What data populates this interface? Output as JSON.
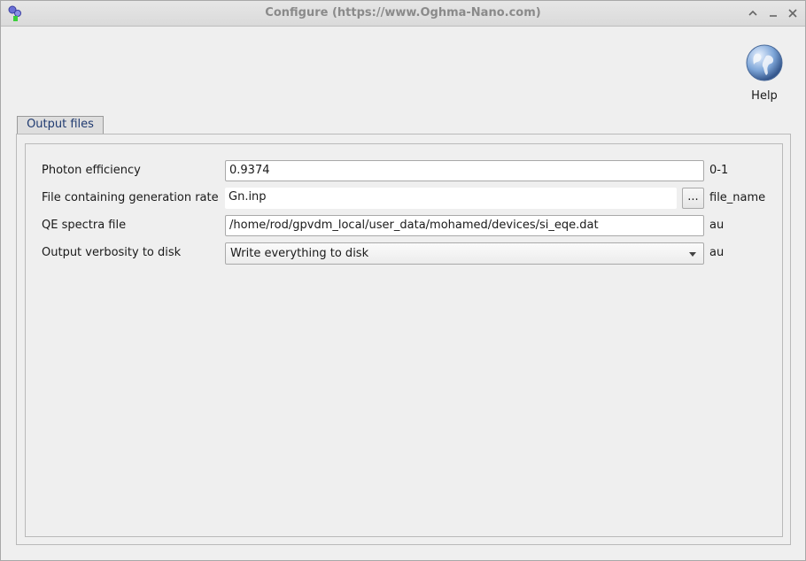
{
  "window": {
    "title": "Configure (https://www.Oghma-Nano.com)",
    "controls": [
      "chevron-up-icon",
      "minimize-icon",
      "close-icon"
    ]
  },
  "toolbar": {
    "help_label": "Help"
  },
  "tabs": [
    {
      "label": "Output files",
      "active": true
    }
  ],
  "form": {
    "rows": [
      {
        "label": "Photon efficiency",
        "value": "0.9374",
        "unit": "0-1"
      },
      {
        "label": "File containing generation rate",
        "value": "Gn.inp",
        "unit": "file_name",
        "browse_label": "..."
      },
      {
        "label": "QE spectra file",
        "value": "/home/rod/gpvdm_local/user_data/mohamed/devices/si_eqe.dat",
        "unit": "au"
      },
      {
        "label": "Output verbosity to disk",
        "value": "Write everything to disk",
        "unit": "au"
      }
    ]
  },
  "colors": {
    "tab_accent": "#3c5a9a",
    "tab_text": "#1f3a70"
  }
}
